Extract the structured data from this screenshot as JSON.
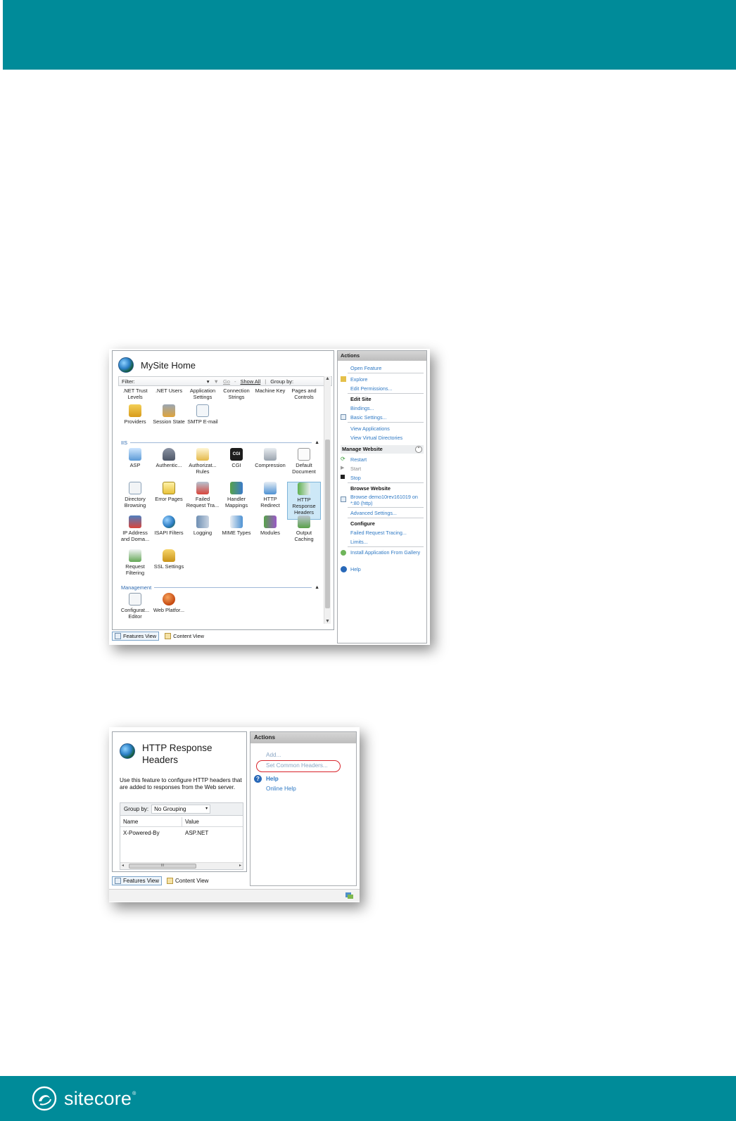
{
  "brand": {
    "name": "sitecore",
    "trademark": "®"
  },
  "colors": {
    "band": "#008b99",
    "link": "#2f79c4",
    "highlight": "#d8242b"
  },
  "screenshot1": {
    "title": "MySite Home",
    "toolbar": {
      "filter_label": "Filter:",
      "go_label": "Go",
      "show_all_label": "Show All",
      "group_by_label": "Group by:"
    },
    "top_items": [
      {
        "label": ".NET Trust Levels",
        "icon": "trust-levels-icon"
      },
      {
        "label": ".NET Users",
        "icon": "users-icon"
      },
      {
        "label": "Application Settings",
        "icon": "app-settings-icon"
      },
      {
        "label": "Connection Strings",
        "icon": "connection-strings-icon"
      },
      {
        "label": "Machine Key",
        "icon": "machine-key-icon"
      },
      {
        "label": "Pages and Controls",
        "icon": "pages-controls-icon"
      },
      {
        "label": "Providers",
        "icon": "providers-icon"
      },
      {
        "label": "Session State",
        "icon": "session-state-icon"
      },
      {
        "label": "SMTP E-mail",
        "icon": "smtp-email-icon"
      }
    ],
    "iis_section": "IIS",
    "iis_items": [
      {
        "label": "ASP",
        "icon": "asp-icon"
      },
      {
        "label": "Authentic...",
        "icon": "authentication-icon"
      },
      {
        "label": "Authorizat... Rules",
        "icon": "authorization-icon"
      },
      {
        "label": "CGI",
        "icon": "cgi-icon"
      },
      {
        "label": "Compression",
        "icon": "compression-icon"
      },
      {
        "label": "Default Document",
        "icon": "default-document-icon"
      },
      {
        "label": "Directory Browsing",
        "icon": "directory-browsing-icon"
      },
      {
        "label": "Error Pages",
        "icon": "error-pages-icon"
      },
      {
        "label": "Failed Request Tra...",
        "icon": "failed-request-icon"
      },
      {
        "label": "Handler Mappings",
        "icon": "handler-mappings-icon"
      },
      {
        "label": "HTTP Redirect",
        "icon": "http-redirect-icon"
      },
      {
        "label": "HTTP Response Headers",
        "icon": "http-response-headers-icon"
      },
      {
        "label": "IP Address and Doma...",
        "icon": "ip-address-icon"
      },
      {
        "label": "ISAPI Filters",
        "icon": "isapi-filters-icon"
      },
      {
        "label": "Logging",
        "icon": "logging-icon"
      },
      {
        "label": "MIME Types",
        "icon": "mime-types-icon"
      },
      {
        "label": "Modules",
        "icon": "modules-icon"
      },
      {
        "label": "Output Caching",
        "icon": "output-caching-icon"
      },
      {
        "label": "Request Filtering",
        "icon": "request-filtering-icon"
      },
      {
        "label": "SSL Settings",
        "icon": "ssl-settings-icon"
      }
    ],
    "management_section": "Management",
    "management_items": [
      {
        "label": "Configurat... Editor",
        "icon": "config-editor-icon"
      },
      {
        "label": "Web Platfor...",
        "icon": "web-platform-icon"
      }
    ],
    "tabs": {
      "features": "Features View",
      "content": "Content View"
    },
    "actions": {
      "header": "Actions",
      "open_feature": "Open Feature",
      "explore": "Explore",
      "edit_permissions": "Edit Permissions...",
      "edit_site": "Edit Site",
      "bindings": "Bindings...",
      "basic_settings": "Basic Settings...",
      "view_applications": "View Applications",
      "view_virtual_directories": "View Virtual Directories",
      "manage_website": "Manage Website",
      "restart": "Restart",
      "start": "Start",
      "stop": "Stop",
      "browse_website": "Browse Website",
      "browse_link": "Browse demo10rev161019 on *:80 (http)",
      "advanced_settings": "Advanced Settings...",
      "configure": "Configure",
      "failed_request_tracing": "Failed Request Tracing...",
      "limits": "Limits...",
      "install_app": "Install Application From Gallery",
      "help": "Help"
    }
  },
  "screenshot2": {
    "title": "HTTP Response Headers",
    "description": "Use this feature to configure HTTP headers that are added to responses from the Web server.",
    "group_by_label": "Group by:",
    "group_by_value": "No Grouping",
    "columns": [
      "Name",
      "Value"
    ],
    "rows": [
      {
        "name": "X-Powered-By",
        "value": "ASP.NET"
      }
    ],
    "tabs": {
      "features": "Features View",
      "content": "Content View"
    },
    "actions": {
      "header": "Actions",
      "add": "Add...",
      "set_common_headers": "Set Common Headers...",
      "help": "Help",
      "online_help": "Online Help"
    }
  }
}
